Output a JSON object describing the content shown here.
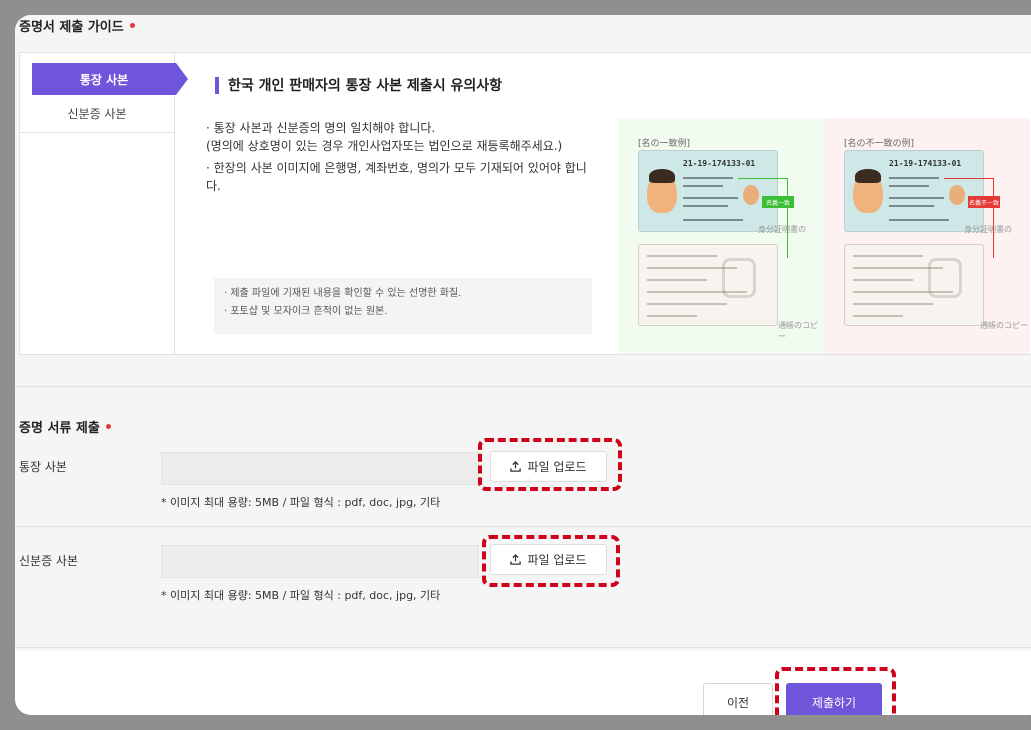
{
  "guide": {
    "title": "증명서 제출 가이드",
    "tabs": [
      {
        "label": "통장 사본",
        "active": true
      },
      {
        "label": "신분증 사본",
        "active": false
      }
    ],
    "heading": "한국 개인 판매자의 통장 사본 제출시 유의사항",
    "rules": [
      "· 통장 사본과 신분증의 명의 일치해야 합니다.",
      "(명의에 상호명이 있는 경우 개인사업자또는 법인으로 재등록해주세요.)",
      "· 한장의 사본 이미지에 은행명, 계좌번호, 명의가 모두 기재되어 있어야 합니다."
    ],
    "notes": [
      "· 제출 파일에 기재된 내용을 확인할 수 있는 선명한 화질.",
      "· 포토샵 및 모자이크 흔적이 없는 원본."
    ],
    "examples": {
      "match_label": "[名の一致例]",
      "mismatch_label": "[名の不一致の例]",
      "match_tag": "名義一致",
      "mismatch_tag": "名義不一致",
      "id_number": "21-19-174133-01",
      "caption_id": "身分証明書の",
      "caption_bankbook": "通帳のコピー"
    }
  },
  "submission": {
    "title": "증명 서류 제출",
    "rows": [
      {
        "label": "통장 사본",
        "button": "파일 업로드",
        "hint": "* 이미지 최대 용량: 5MB / 파일 형식 : pdf, doc, jpg, 기타"
      },
      {
        "label": "신분증 사본",
        "button": "파일 업로드",
        "hint": "* 이미지 최대 용량: 5MB / 파일 형식 : pdf, doc, jpg, 기타"
      }
    ]
  },
  "footer": {
    "prev_label": "이전",
    "submit_label": "제출하기"
  },
  "colors": {
    "accent": "#6f55d9",
    "required": "#e53935",
    "highlight": "#d0021b"
  }
}
